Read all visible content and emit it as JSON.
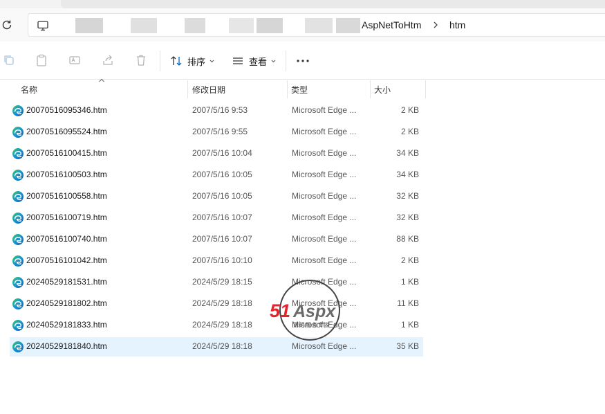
{
  "address": {
    "breadcrumbs": [
      "AspNetToHtm",
      "htm"
    ]
  },
  "toolbar": {
    "sort_label": "排序",
    "view_label": "查看"
  },
  "columns": {
    "name": "名称",
    "date": "修改日期",
    "type": "类型",
    "size": "大小"
  },
  "files": [
    {
      "name": "20070516095346.htm",
      "date": "2007/5/16 9:53",
      "type": "Microsoft Edge ...",
      "size": "2 KB"
    },
    {
      "name": "20070516095524.htm",
      "date": "2007/5/16 9:55",
      "type": "Microsoft Edge ...",
      "size": "2 KB"
    },
    {
      "name": "20070516100415.htm",
      "date": "2007/5/16 10:04",
      "type": "Microsoft Edge ...",
      "size": "34 KB"
    },
    {
      "name": "20070516100503.htm",
      "date": "2007/5/16 10:05",
      "type": "Microsoft Edge ...",
      "size": "34 KB"
    },
    {
      "name": "20070516100558.htm",
      "date": "2007/5/16 10:05",
      "type": "Microsoft Edge ...",
      "size": "32 KB"
    },
    {
      "name": "20070516100719.htm",
      "date": "2007/5/16 10:07",
      "type": "Microsoft Edge ...",
      "size": "32 KB"
    },
    {
      "name": "20070516100740.htm",
      "date": "2007/5/16 10:07",
      "type": "Microsoft Edge ...",
      "size": "88 KB"
    },
    {
      "name": "20070516101042.htm",
      "date": "2007/5/16 10:10",
      "type": "Microsoft Edge ...",
      "size": "2 KB"
    },
    {
      "name": "20240529181531.htm",
      "date": "2024/5/29 18:15",
      "type": "Microsoft Edge ...",
      "size": "1 KB"
    },
    {
      "name": "20240529181802.htm",
      "date": "2024/5/29 18:18",
      "type": "Microsoft Edge ...",
      "size": "11 KB"
    },
    {
      "name": "20240529181833.htm",
      "date": "2024/5/29 18:18",
      "type": "Microsoft Edge ...",
      "size": "1 KB"
    },
    {
      "name": "20240529181840.htm",
      "date": "2024/5/29 18:18",
      "type": "Microsoft Edge ...",
      "size": "35 KB",
      "selected": true
    }
  ],
  "watermark": {
    "brand": "51Aspx",
    "tagline": "源码服务专家"
  },
  "icons": {
    "file": "edge-html-file-icon",
    "refresh": "refresh-icon",
    "pc": "this-pc-icon"
  },
  "colors": {
    "selection": "#e5f3ff",
    "edge_blue": "#0c59a4",
    "edge_green": "#3bc96c",
    "watermark_red": "#e3262e"
  }
}
